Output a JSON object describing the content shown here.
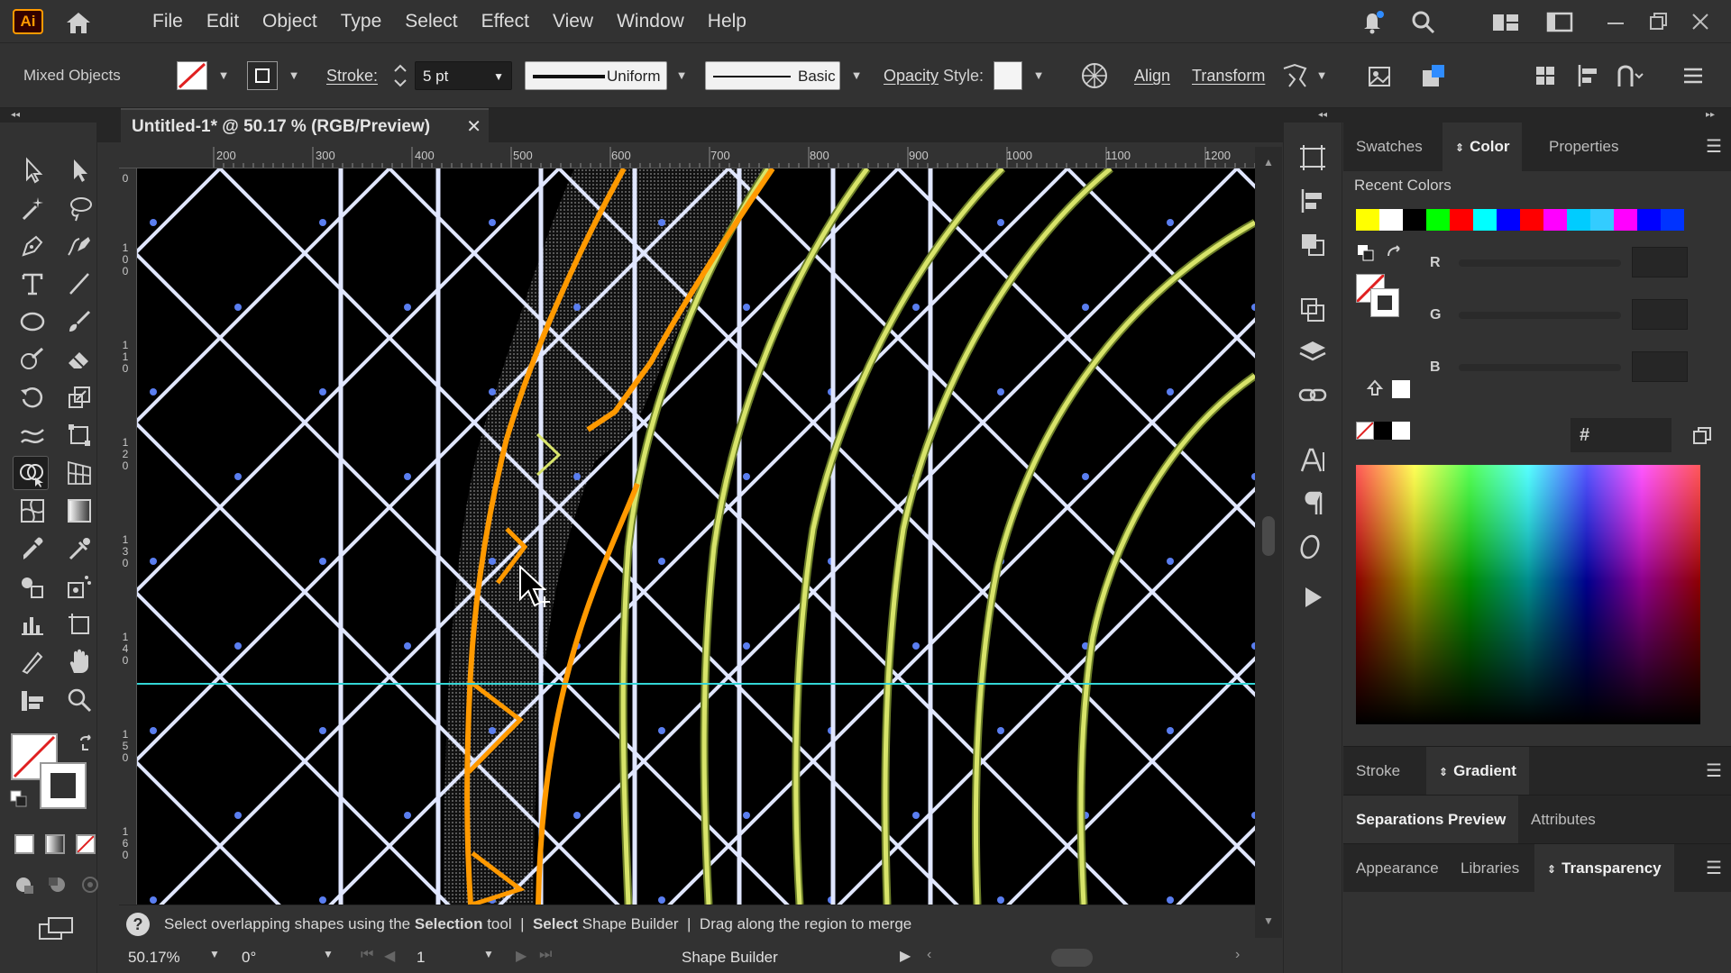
{
  "menu": {
    "logo": "Ai",
    "items": [
      "File",
      "Edit",
      "Object",
      "Type",
      "Select",
      "Effect",
      "View",
      "Window",
      "Help"
    ]
  },
  "control_bar": {
    "selection_label": "Mixed Objects",
    "stroke_label": "Stroke:",
    "stroke_weight": "5 pt",
    "profile": "Uniform",
    "brush": "Basic",
    "opacity_label": "Opacity",
    "style_label": "Style:",
    "align_label": "Align",
    "transform_label": "Transform"
  },
  "document": {
    "tab_title": "Untitled-1* @ 50.17 % (RGB/Preview)",
    "close_glyph": "✕",
    "ruler_h": [
      "200",
      "300",
      "400",
      "500",
      "600",
      "700",
      "800",
      "900",
      "1000",
      "1100",
      "1200"
    ],
    "ruler_v": [
      "0",
      "1\n0\n0",
      "1\n1\n0",
      "1\n2\n0",
      "1\n3\n0",
      "1\n4\n0",
      "1\n5\n0",
      "1\n6\n0"
    ]
  },
  "status": {
    "hint_icon": "?",
    "hint_part1": "Select overlapping shapes using the",
    "hint_bold1": "Selection",
    "hint_part2": "tool",
    "hint_sep1": "|",
    "hint_bold2": "Select",
    "hint_part3": "Shape Builder",
    "hint_sep2": "|",
    "hint_part4": "Drag along the region to merge",
    "zoom": "50.17%",
    "rotation": "0°",
    "artboard": "1",
    "active_tool": "Shape Builder"
  },
  "panels": {
    "top_tabs": [
      "Swatches",
      "Color",
      "Properties"
    ],
    "active_top_tab": "Color",
    "recent_colors_label": "Recent Colors",
    "recent_colors": [
      "#ffff00",
      "#ffffff",
      "#000000",
      "#00ff00",
      "#ff0000",
      "#00ffff",
      "#0000ff",
      "#ff0000",
      "#ff00ff",
      "#00ccff",
      "#33ccff",
      "#ff00ff",
      "#0000ff",
      "#0033ff"
    ],
    "slider_labels": [
      "R",
      "G",
      "B"
    ],
    "hex_label": "#",
    "tabs_stroke": [
      "Stroke",
      "Gradient"
    ],
    "tabs_sep": [
      "Separations Preview",
      "Attributes"
    ],
    "tabs_app": [
      "Appearance",
      "Libraries",
      "Transparency"
    ]
  },
  "colors": {
    "grid_line": "#e0e6ff",
    "grid_node": "#5a7ef0",
    "yellow_arc": "#d8e46a",
    "orange_stroke": "#ff9900",
    "guide": "#33d6d6"
  }
}
